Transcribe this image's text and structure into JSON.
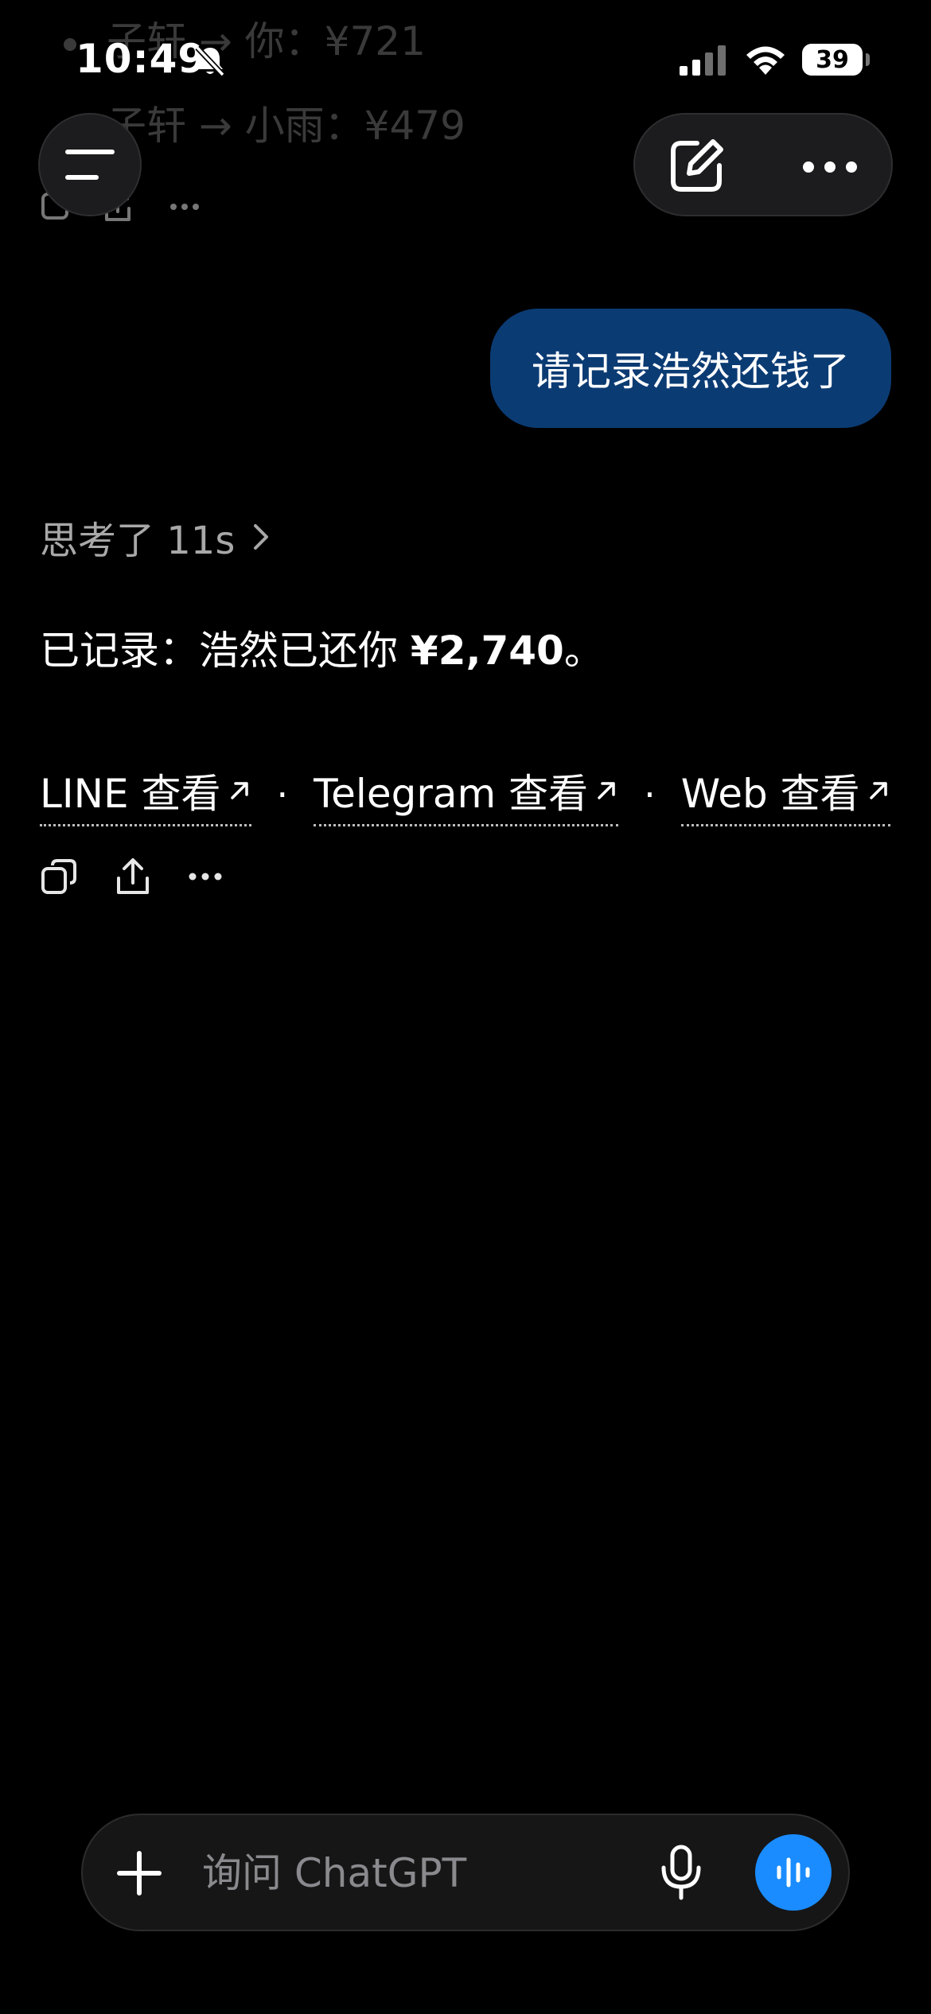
{
  "background_list": {
    "items": [
      {
        "text": "子轩 → 你：¥721"
      },
      {
        "text": "子轩 → 小雨：¥479"
      }
    ]
  },
  "status_bar": {
    "time": "10:49",
    "battery": "39"
  },
  "conversation": {
    "user_message": "请记录浩然还钱了",
    "thinking_label": "思考了 11s",
    "reply_prefix": "已记录：浩然已还你 ",
    "reply_amount": "¥2,740",
    "reply_suffix": "。",
    "links": [
      {
        "label": "LINE 查看"
      },
      {
        "label": "Telegram 查看"
      },
      {
        "label": "Web 查看"
      }
    ],
    "separator": "·"
  },
  "composer": {
    "placeholder": "询问 ChatGPT"
  },
  "colors": {
    "background": "#000000",
    "user_bubble": "#0b3b73",
    "voice_button": "#1a8cff"
  }
}
